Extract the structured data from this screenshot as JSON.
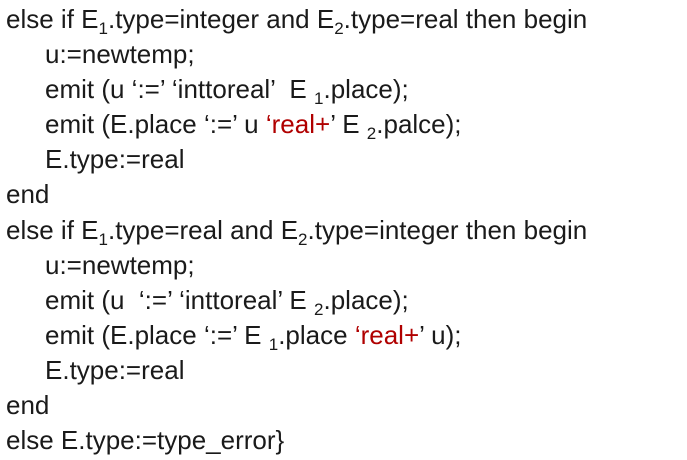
{
  "colors": {
    "text": "#1a1a1a",
    "highlight": "#b00000",
    "background": "#ffffff"
  },
  "code": {
    "line1": {
      "a": "else if E",
      "s1": "1",
      "b": ".type=integer and E",
      "s2": "2",
      "c": ".type=real then begin"
    },
    "line2": {
      "a": "u:=newtemp;"
    },
    "line3": {
      "a": "emit (u ‘:=’ ‘inttoreal’  E ",
      "s1": "1",
      "b": ".place);"
    },
    "line4": {
      "a": "emit (E.place ‘:=’ u ",
      "red": "‘real+",
      "b": "’ E ",
      "s1": "2",
      "c": ".palce);"
    },
    "line5": {
      "a": "E.type:=real"
    },
    "line6": {
      "a": "end"
    },
    "line7": {
      "a": "else if E",
      "s1": "1",
      "b": ".type=real and E",
      "s2": "2",
      "c": ".type=integer then begin"
    },
    "line8": {
      "a": "u:=newtemp;"
    },
    "line9": {
      "a": "emit (u  ‘:=’ ‘inttoreal’ E ",
      "s1": "2",
      "b": ".place);"
    },
    "line10": {
      "a": "emit (E.place ‘:=’ E ",
      "s1": "1",
      "b": ".place ",
      "red": "‘real+",
      "c": "’ u);"
    },
    "line11": {
      "a": "E.type:=real"
    },
    "line12": {
      "a": "end"
    },
    "line13": {
      "a": "else E.type:=type_error}"
    }
  }
}
